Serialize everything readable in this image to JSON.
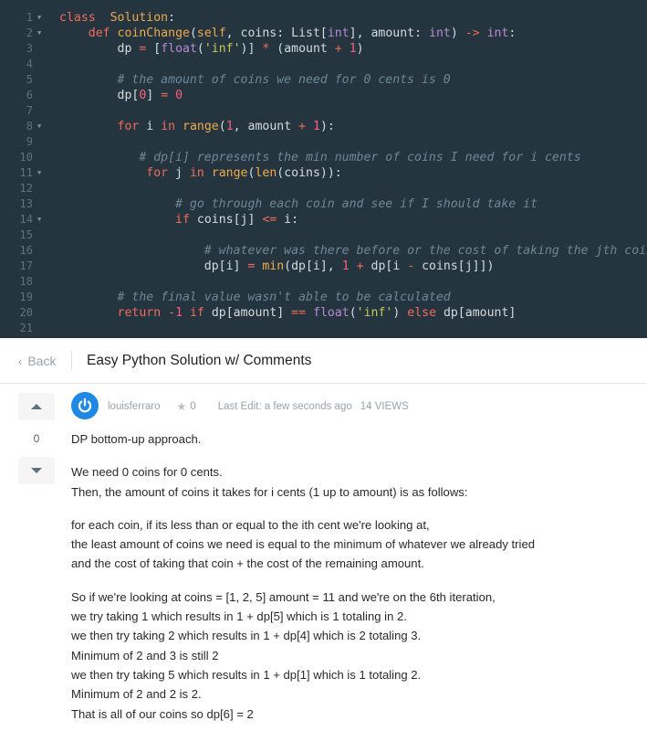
{
  "code": {
    "lines": [
      {
        "n": "1",
        "fold": true
      },
      {
        "n": "2",
        "fold": true
      },
      {
        "n": "3",
        "fold": false
      },
      {
        "n": "4",
        "fold": false
      },
      {
        "n": "5",
        "fold": false
      },
      {
        "n": "6",
        "fold": false
      },
      {
        "n": "7",
        "fold": false
      },
      {
        "n": "8",
        "fold": true
      },
      {
        "n": "9",
        "fold": false
      },
      {
        "n": "10",
        "fold": false
      },
      {
        "n": "11",
        "fold": true
      },
      {
        "n": "12",
        "fold": false
      },
      {
        "n": "13",
        "fold": false
      },
      {
        "n": "14",
        "fold": true
      },
      {
        "n": "15",
        "fold": false
      },
      {
        "n": "16",
        "fold": false
      },
      {
        "n": "17",
        "fold": false
      },
      {
        "n": "18",
        "fold": false
      },
      {
        "n": "19",
        "fold": false
      },
      {
        "n": "20",
        "fold": false
      },
      {
        "n": "21",
        "fold": false
      }
    ],
    "tokens": {
      "l1": [
        [
          "kw",
          "class"
        ],
        [
          "",
          "  "
        ],
        [
          "fn",
          "Solution"
        ],
        [
          "",
          ":"
        ]
      ],
      "l2": [
        [
          "",
          "    "
        ],
        [
          "kw",
          "def"
        ],
        [
          "",
          " "
        ],
        [
          "fn",
          "coinChange"
        ],
        [
          "",
          "("
        ],
        [
          "fn",
          "self"
        ],
        [
          "",
          ", coins: List["
        ],
        [
          "ty",
          "int"
        ],
        [
          "",
          "], amount: "
        ],
        [
          "ty",
          "int"
        ],
        [
          "",
          ") "
        ],
        [
          "op",
          "->"
        ],
        [
          "",
          " "
        ],
        [
          "ty",
          "int"
        ],
        [
          "",
          ":"
        ]
      ],
      "l3": [
        [
          "",
          "        dp "
        ],
        [
          "op",
          "="
        ],
        [
          "",
          " ["
        ],
        [
          "ty",
          "float"
        ],
        [
          "",
          "("
        ],
        [
          "str",
          "'inf'"
        ],
        [
          "",
          ")] "
        ],
        [
          "op",
          "*"
        ],
        [
          "",
          " (amount "
        ],
        [
          "op",
          "+"
        ],
        [
          "",
          " "
        ],
        [
          "num",
          "1"
        ],
        [
          "",
          ")"
        ]
      ],
      "l4": [],
      "l5": [
        [
          "",
          "        "
        ],
        [
          "cm",
          "# the amount of coins we need for 0 cents is 0"
        ]
      ],
      "l6": [
        [
          "",
          "        dp["
        ],
        [
          "num",
          "0"
        ],
        [
          "",
          "] "
        ],
        [
          "op",
          "="
        ],
        [
          "",
          " "
        ],
        [
          "num",
          "0"
        ]
      ],
      "l7": [],
      "l8": [
        [
          "",
          "        "
        ],
        [
          "kw",
          "for"
        ],
        [
          "",
          " i "
        ],
        [
          "kw",
          "in"
        ],
        [
          "",
          " "
        ],
        [
          "fn",
          "range"
        ],
        [
          "",
          "("
        ],
        [
          "num",
          "1"
        ],
        [
          "",
          ", amount "
        ],
        [
          "op",
          "+"
        ],
        [
          "",
          " "
        ],
        [
          "num",
          "1"
        ],
        [
          "",
          "):"
        ]
      ],
      "l9": [],
      "l10": [
        [
          "",
          "           "
        ],
        [
          "cm",
          "# dp[i] represents the min number of coins I need for i cents"
        ]
      ],
      "l11": [
        [
          "",
          "            "
        ],
        [
          "kw",
          "for"
        ],
        [
          "",
          " j "
        ],
        [
          "kw",
          "in"
        ],
        [
          "",
          " "
        ],
        [
          "fn",
          "range"
        ],
        [
          "",
          "("
        ],
        [
          "fn",
          "len"
        ],
        [
          "",
          "(coins)):"
        ]
      ],
      "l12": [],
      "l13": [
        [
          "",
          "                "
        ],
        [
          "cm",
          "# go through each coin and see if I should take it"
        ]
      ],
      "l14": [
        [
          "",
          "                "
        ],
        [
          "kw",
          "if"
        ],
        [
          "",
          " coins[j] "
        ],
        [
          "op",
          "<="
        ],
        [
          "",
          " i:"
        ]
      ],
      "l15": [],
      "l16": [
        [
          "",
          "                    "
        ],
        [
          "cm",
          "# whatever was there before or the cost of taking the jth coin"
        ]
      ],
      "l17": [
        [
          "",
          "                    dp[i] "
        ],
        [
          "op",
          "="
        ],
        [
          "",
          " "
        ],
        [
          "fn",
          "min"
        ],
        [
          "",
          "(dp[i], "
        ],
        [
          "num",
          "1"
        ],
        [
          "",
          " "
        ],
        [
          "op",
          "+"
        ],
        [
          "",
          " dp[i "
        ],
        [
          "op",
          "-"
        ],
        [
          "",
          " coins[j]])"
        ]
      ],
      "l18": [],
      "l19": [
        [
          "",
          "        "
        ],
        [
          "cm",
          "# the final value wasn't able to be calculated"
        ]
      ],
      "l20": [
        [
          "",
          "        "
        ],
        [
          "kw",
          "return"
        ],
        [
          "",
          " "
        ],
        [
          "op",
          "-"
        ],
        [
          "num",
          "1"
        ],
        [
          "",
          " "
        ],
        [
          "kw",
          "if"
        ],
        [
          "",
          " dp[amount] "
        ],
        [
          "op",
          "=="
        ],
        [
          "",
          " "
        ],
        [
          "ty",
          "float"
        ],
        [
          "",
          "("
        ],
        [
          "str",
          "'inf'"
        ],
        [
          "",
          ") "
        ],
        [
          "kw",
          "else"
        ],
        [
          "",
          " dp[amount]"
        ]
      ],
      "l21": []
    }
  },
  "header": {
    "back_label": "Back",
    "title": "Easy Python Solution w/ Comments"
  },
  "post": {
    "votes": "0",
    "author": "louisferraro",
    "reputation": "0",
    "last_edit": "Last Edit: a few seconds ago",
    "views": "14 VIEWS",
    "paragraphs": [
      [
        "DP bottom-up approach."
      ],
      [
        "We need 0 coins for 0 cents.",
        "Then, the amount of coins it takes for i cents (1 up to amount) is as follows:"
      ],
      [
        "for each coin, if its less than or equal to the ith cent we're looking at,",
        "the least amount of coins we need is equal to the minimum of whatever we already tried",
        "and the cost of taking that coin + the cost of the remaining amount."
      ],
      [
        "So if we're looking at coins = [1, 2, 5] amount = 11 and we're on the 6th iteration,",
        "we try taking 1 which results in 1 + dp[5] which is 1 totaling in 2.",
        "we then try taking 2 which results in 1 + dp[4] which is 2 totaling 3.",
        "Minimum of 2 and 3 is still 2",
        "we then try taking 5 which results in 1 + dp[1] which is 1 totaling 2.",
        "Minimum of 2 and 2 is 2.",
        "That is all of our coins so dp[6] = 2"
      ]
    ]
  },
  "colors": {
    "editor_bg": "#243540",
    "keyword": "#f26b5b",
    "function": "#f0a94a",
    "type": "#b98ad4",
    "number": "#ff5f7e",
    "string": "#c6c85b",
    "comment": "#6f8795",
    "avatar": "#1e88e5"
  },
  "icons": [
    "chevron-left-icon",
    "upvote-icon",
    "downvote-icon",
    "avatar-power-icon",
    "star-icon",
    "fold-arrow-icon"
  ]
}
